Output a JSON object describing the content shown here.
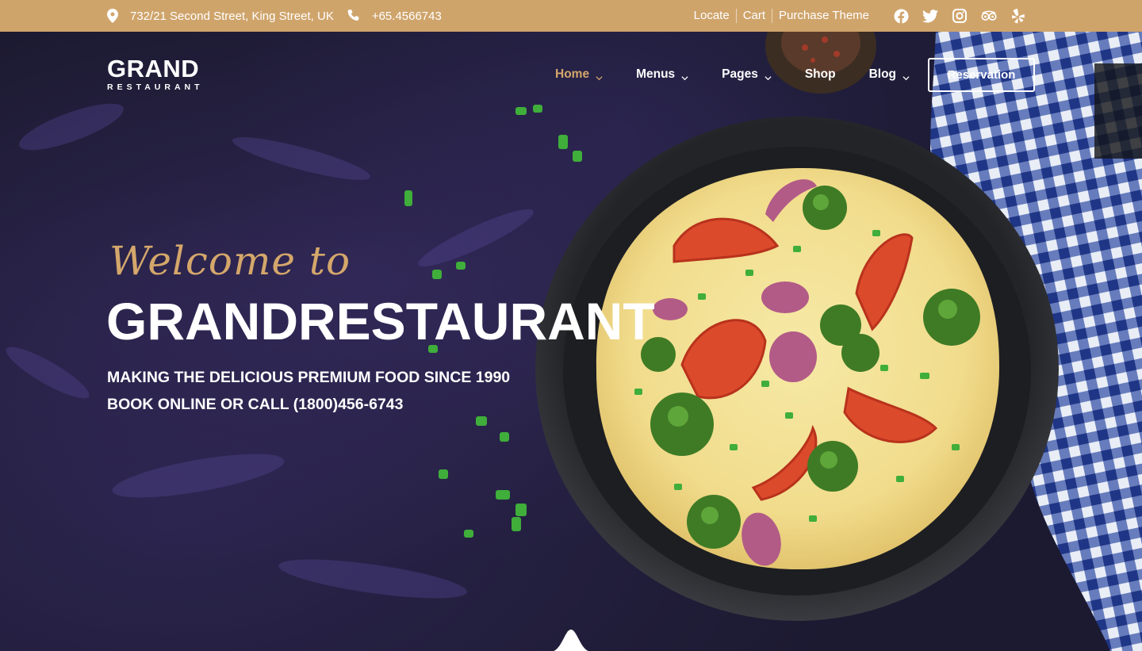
{
  "topbar": {
    "address": "732/21 Second Street, King Street, UK",
    "phone": "+65.4566743",
    "links": [
      "Locate",
      "Cart",
      "Purchase Theme"
    ],
    "social_icons": [
      "facebook-icon",
      "twitter-icon",
      "instagram-icon",
      "tripadvisor-icon",
      "yelp-icon"
    ],
    "accent": "#cfa46b"
  },
  "header": {
    "logo_main": "GRAND",
    "logo_sub": "RESTAURANT",
    "nav": [
      {
        "label": "Home",
        "dropdown": true,
        "active": true
      },
      {
        "label": "Menus",
        "dropdown": true,
        "active": false
      },
      {
        "label": "Pages",
        "dropdown": true,
        "active": false
      },
      {
        "label": "Shop",
        "dropdown": false,
        "active": false
      },
      {
        "label": "Blog",
        "dropdown": true,
        "active": false
      }
    ],
    "reservation_label": "Reservation"
  },
  "hero": {
    "welcome": "Welcome to",
    "headline": "GRANDRESTAURANT",
    "line1": "MAKING THE DELICIOUS PREMIUM FOOD SINCE 1990",
    "line2": "BOOK ONLINE OR CALL (1800)456-6743"
  },
  "colors": {
    "gold": "#d4a76b",
    "background": "#1c1a31",
    "white": "#ffffff"
  }
}
